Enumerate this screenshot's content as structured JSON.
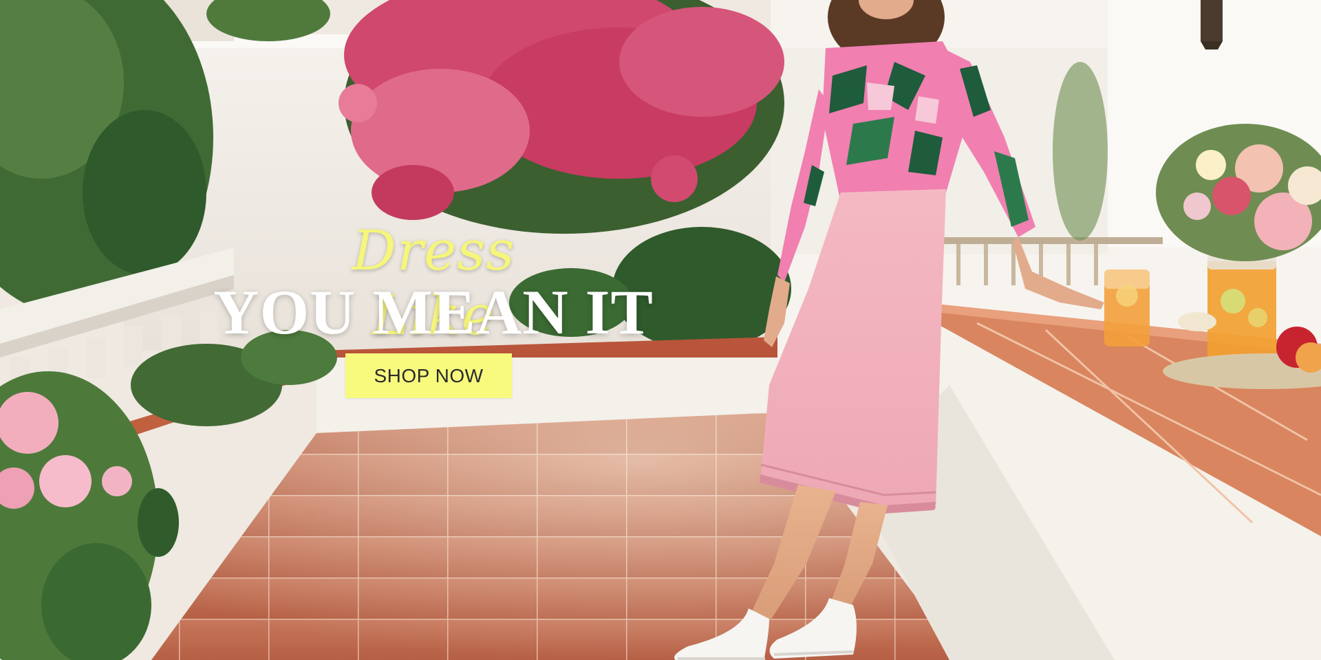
{
  "hero": {
    "script_line": "Dress Like",
    "headline": "YOU MEAN IT",
    "cta_label": "SHOP NOW",
    "cta_color": "#f7fa7d",
    "script_color": "#f5f67a",
    "headline_color": "#ffffff",
    "scene": "sunny-patio-with-woman-in-pink-dress"
  }
}
